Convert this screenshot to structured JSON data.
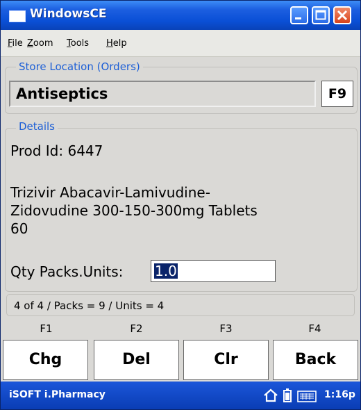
{
  "window": {
    "title": "WindowsCE"
  },
  "menu": {
    "items": [
      {
        "key": "F",
        "rest": "ile"
      },
      {
        "key": "Z",
        "rest": "oom"
      },
      {
        "key": "T",
        "rest": "ools"
      },
      {
        "key": "H",
        "rest": "elp"
      }
    ]
  },
  "store": {
    "legend": "Store Location (Orders)",
    "value": "Antiseptics",
    "lookup_button": "F9"
  },
  "details": {
    "legend": "Details",
    "prod_id": "Prod Id: 6447",
    "desc_line1": "Trizivir Abacavir-Lamivudine-",
    "desc_line2": "Zidovudine 300-150-300mg Tablets",
    "desc_line3": "60",
    "qty_label": "Qty Packs.Units:",
    "qty_value": "1.0"
  },
  "status": {
    "text": "4 of 4 / Packs = 9 / Units = 4"
  },
  "function_keys": [
    "F1",
    "F2",
    "F3",
    "F4"
  ],
  "soft_buttons": [
    "Chg",
    "Del",
    "Clr",
    "Back"
  ],
  "taskbar": {
    "app_name": "iSOFT i.Pharmacy",
    "time": "1:16p"
  },
  "colors": {
    "title_bar": "#0a4fd6",
    "legend_text": "#1d5fd6",
    "selection": "#0a246a",
    "taskbar": "#1b56d9"
  }
}
